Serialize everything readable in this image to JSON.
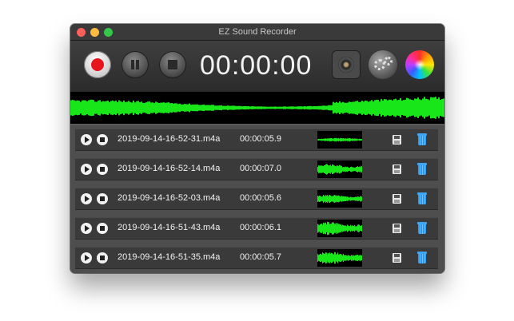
{
  "window": {
    "title": "EZ Sound Recorder"
  },
  "toolbar": {
    "timer": "00:00:00",
    "icons": {
      "record": "record-icon",
      "pause": "pause-icon",
      "stop": "stop-icon",
      "audio_settings": "speaker-icon",
      "preferences": "gears-icon",
      "color_theme": "color-wheel-icon"
    }
  },
  "colors": {
    "waveform": "#19e619",
    "record": "#e8141c",
    "trash": "#2f97ee"
  },
  "recordings": [
    {
      "filename": "2019-09-14-16-52-31.m4a",
      "duration": "00:00:05.9",
      "level": 0.25
    },
    {
      "filename": "2019-09-14-16-52-14.m4a",
      "duration": "00:00:07.0",
      "level": 0.7
    },
    {
      "filename": "2019-09-14-16-52-03.m4a",
      "duration": "00:00:05.6",
      "level": 0.55
    },
    {
      "filename": "2019-09-14-16-51-43.m4a",
      "duration": "00:00:06.1",
      "level": 0.85
    },
    {
      "filename": "2019-09-14-16-51-35.m4a",
      "duration": "00:00:05.7",
      "level": 0.8
    }
  ]
}
